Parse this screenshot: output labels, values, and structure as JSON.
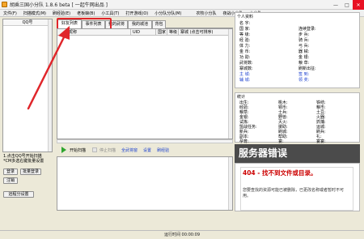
{
  "window": {
    "title": "胡乘三国小分队 1.8.6 beta [ 一起牛网出品 ]",
    "controls": {
      "minimize": "—",
      "maximize": "□",
      "close": "✕"
    }
  },
  "menu": [
    "文件(F)",
    "扫描模式(M)",
    "刷经验(E)",
    "老板娘(B)",
    "小工具(T)",
    "打开游戏(O)",
    "小分队分队(M)",
    "农牧小分队",
    "夜战小分队",
    "小分队"
  ],
  "left": {
    "header": "QQ号",
    "info": [
      "1.点击QQ号开始扫描",
      "*CM多选右键批量设置"
    ],
    "buttons": {
      "login": "登录",
      "batch_login": "批量登录",
      "logout": "注销",
      "team_settings": "远程分设置"
    }
  },
  "tabs": [
    "好友列表",
    "事件列表",
    "我的武将",
    "我的城池",
    "背包"
  ],
  "grid_columns": [
    "昵称",
    "UID",
    "国家",
    "等级",
    "寨城 (点击可排序)"
  ],
  "controls": {
    "start_scan": "开始扫描",
    "stop_scan": "停止扫描",
    "check_all": "全武将窗",
    "settings": "设置",
    "refresh": "刷经验"
  },
  "profile": {
    "section": "个人资料",
    "fields_left": [
      "名 字:",
      "国 家:",
      "等 级:",
      "经 验:",
      "体 力:",
      "金 币:",
      "功 勋:",
      "武将数:",
      "寨城数:"
    ],
    "links_left": [
      "主 城:",
      "辅 城:"
    ],
    "fields_right": [
      "连续登录:",
      "步 兵:",
      "骑 兵:",
      "弓 兵:",
      "器 械:",
      "金 银:",
      "粮 草:",
      "刷新出征:"
    ],
    "links_right": [
      "签 到:",
      "领 奖:"
    ]
  },
  "stats": {
    "section": "统计",
    "col1": [
      "出生:",
      "经验:",
      "粮草:",
      "金银:",
      "试炼:",
      "盟战任务:",
      "新兵:",
      "副本:",
      "孕育:"
    ],
    "col2": [
      "桃木:",
      "铜币:",
      "士兵:",
      "野兽:",
      "灭火:",
      "援助:",
      "刷城:",
      "帮助:",
      "宴:"
    ],
    "col3": [
      "铁结:",
      "粮市:",
      "土豆:",
      "火器:",
      "抓捕:",
      "运城:",
      "刷兵:",
      "礼:",
      "宴宴:"
    ]
  },
  "error": {
    "banner": "服务器错误",
    "code": "404 - 找不到文件或目录。",
    "message": "您要查找的资源可能已被删除，已更改名称或者暂时不可用。"
  },
  "status": "运行时间 00:00:09",
  "colors": {
    "annotation": "#e0262b",
    "error_banner": "#4b4b4b",
    "error_code": "#cc0000",
    "link": "#1a3fcf"
  }
}
